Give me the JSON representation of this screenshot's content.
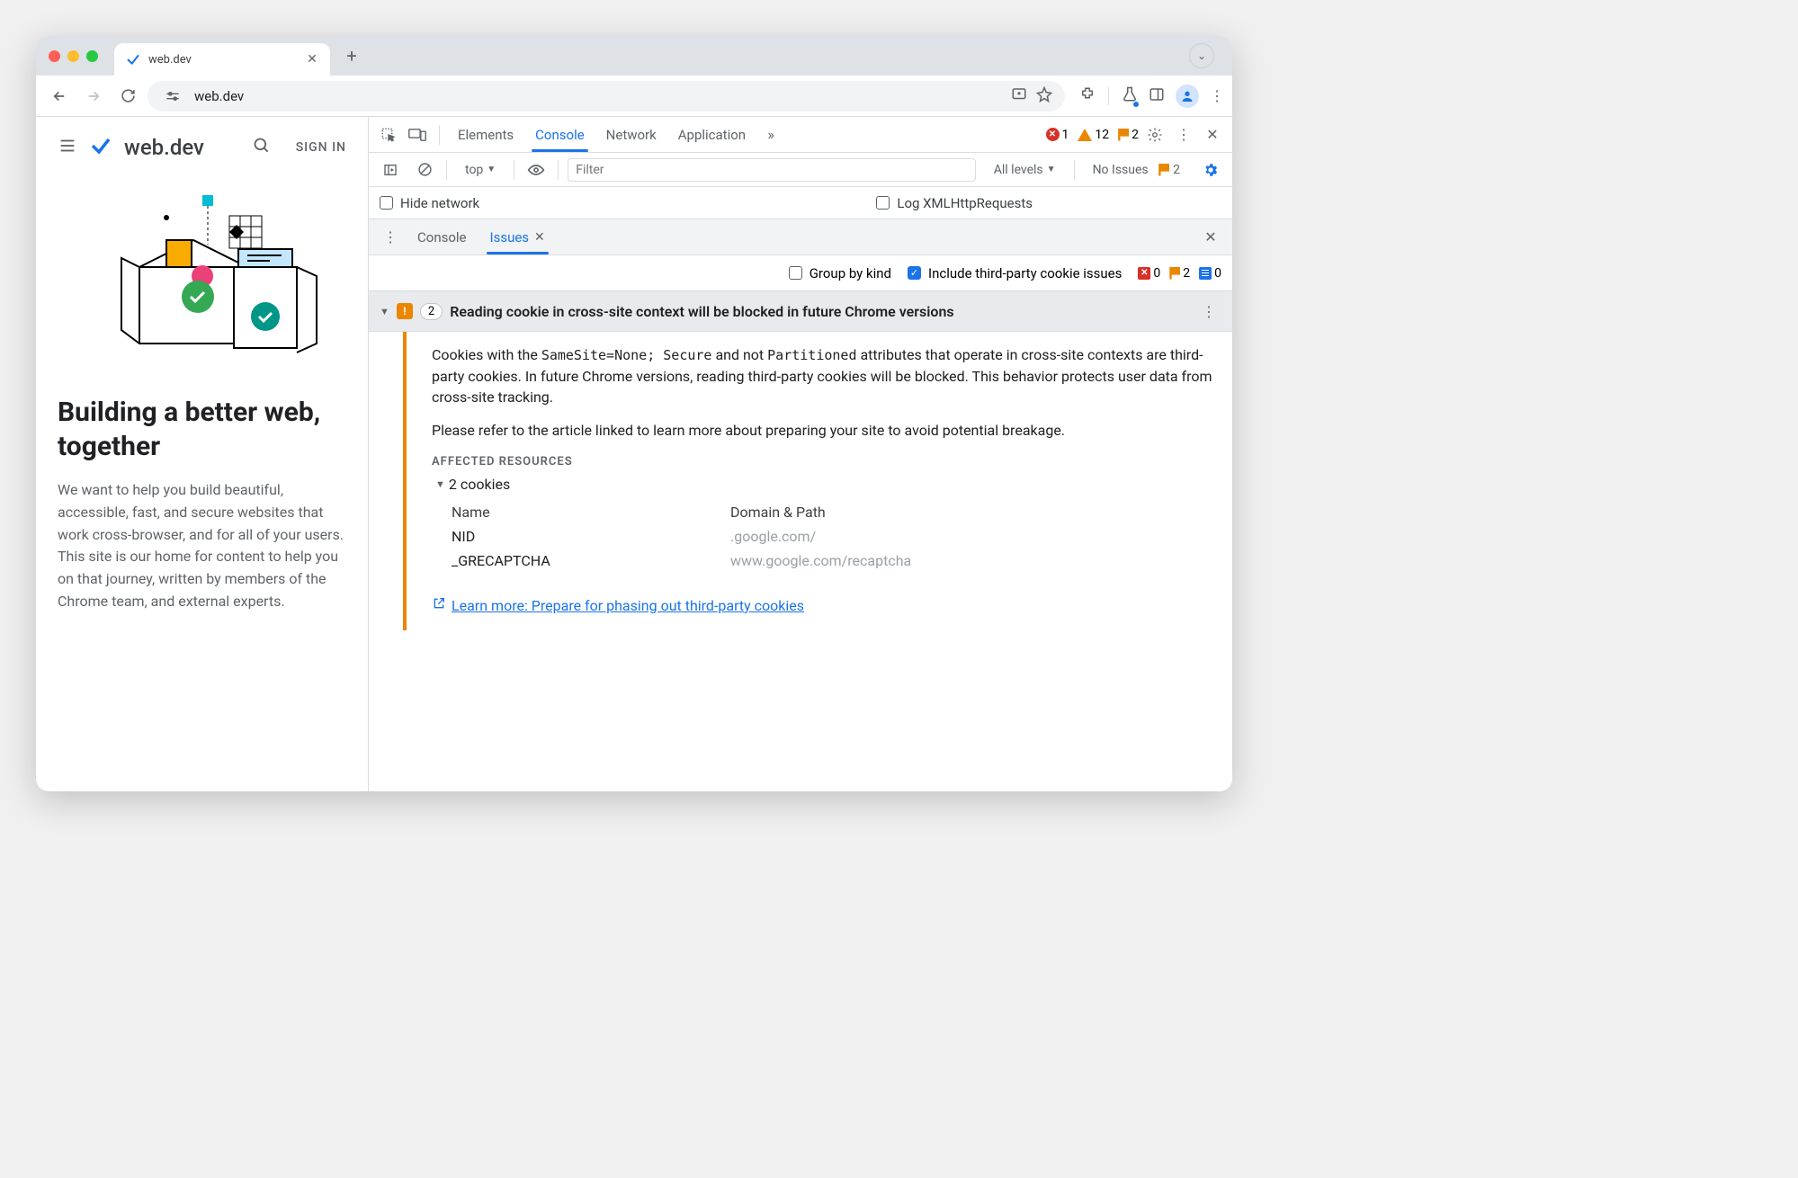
{
  "tab": {
    "title": "web.dev"
  },
  "url": "web.dev",
  "page": {
    "logo": "web.dev",
    "signin": "SIGN IN",
    "heading": "Building a better web, together",
    "description": "We want to help you build beautiful, accessible, fast, and secure websites that work cross-browser, and for all of your users. This site is our home for content to help you on that journey, written by members of the Chrome team, and external experts."
  },
  "devtools": {
    "tabs": {
      "elements": "Elements",
      "console": "Console",
      "network": "Network",
      "application": "Application"
    },
    "counts": {
      "errors": "1",
      "warnings": "12",
      "issues": "2"
    },
    "console_toolbar": {
      "context": "top",
      "filter_placeholder": "Filter",
      "levels": "All levels",
      "no_issues": "No Issues",
      "issues_num": "2"
    },
    "console_opts": {
      "hide_network": "Hide network",
      "log_xhr": "Log XMLHttpRequests"
    },
    "drawer": {
      "console": "Console",
      "issues": "Issues"
    },
    "issues_opts": {
      "group": "Group by kind",
      "include3p": "Include third-party cookie issues",
      "sev_err": "0",
      "sev_warn": "2",
      "sev_info": "0"
    },
    "issue": {
      "count": "2",
      "title": "Reading cookie in cross-site context will be blocked in future Chrome versions",
      "p1a": "Cookies with the ",
      "code1": "SameSite=None; Secure",
      "p1b": " and not ",
      "code2": "Partitioned",
      "p1c": " attributes that operate in cross-site contexts are third-party cookies. In future Chrome versions, reading third-party cookies will be blocked. This behavior protects user data from cross-site tracking.",
      "p2": "Please refer to the article linked to learn more about preparing your site to avoid potential breakage.",
      "affected_label": "AFFECTED RESOURCES",
      "cookies_toggle": "2 cookies",
      "th_name": "Name",
      "th_domain": "Domain & Path",
      "rows": [
        {
          "name": "NID",
          "domain": ".google.com/"
        },
        {
          "name": "_GRECAPTCHA",
          "domain": "www.google.com/recaptcha"
        }
      ],
      "learn_more": "Learn more: Prepare for phasing out third-party cookies"
    }
  }
}
